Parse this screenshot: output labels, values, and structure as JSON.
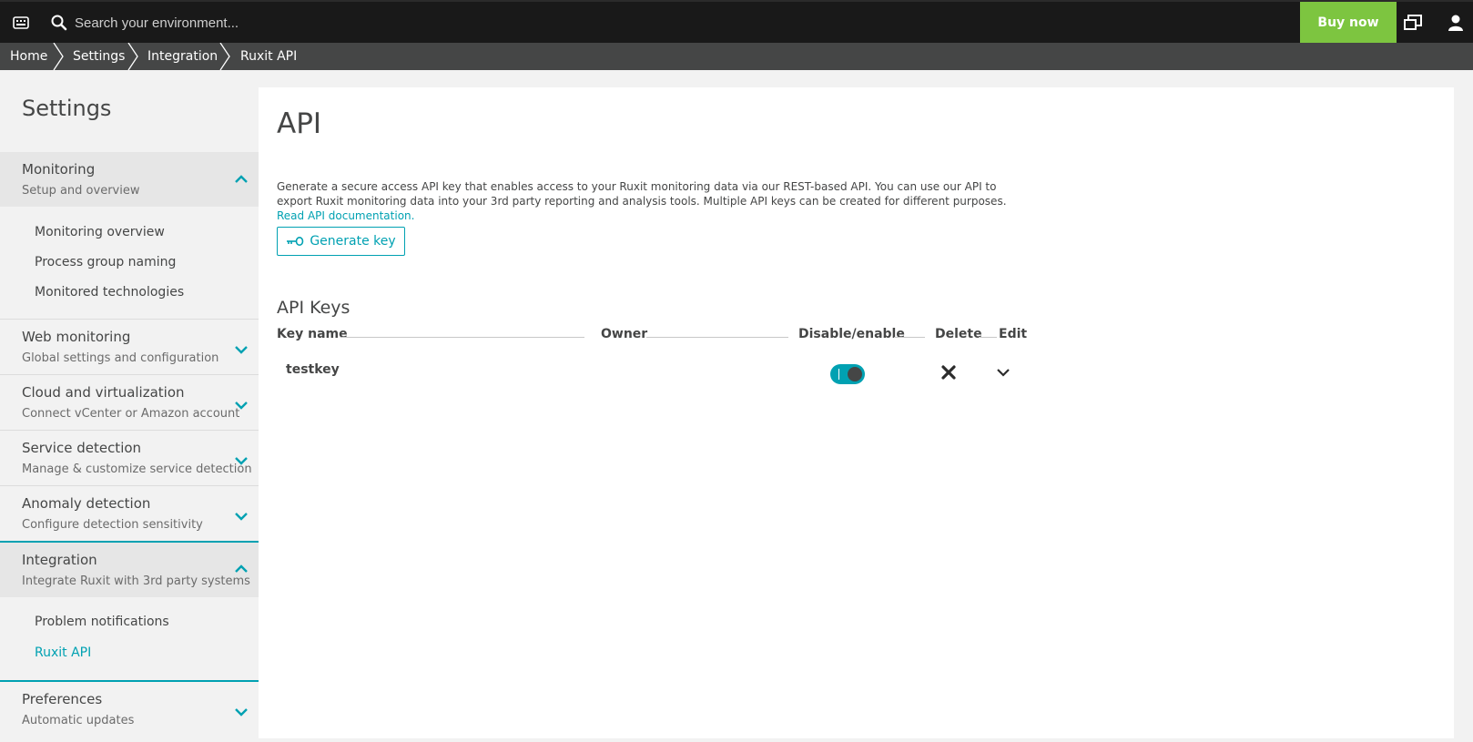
{
  "topbar": {
    "search_placeholder": "Search your environment...",
    "buy_label": "Buy now"
  },
  "breadcrumb": [
    "Home",
    "Settings",
    "Integration",
    "Ruxit API"
  ],
  "sidebar": {
    "title": "Settings",
    "sections": [
      {
        "title": "Monitoring",
        "subtitle": "Setup and overview",
        "expanded": true,
        "items": [
          "Monitoring overview",
          "Process group naming",
          "Monitored technologies"
        ]
      },
      {
        "title": "Web monitoring",
        "subtitle": "Global settings and configuration",
        "expanded": false
      },
      {
        "title": "Cloud and virtualization",
        "subtitle": "Connect vCenter or Amazon account",
        "expanded": false
      },
      {
        "title": "Service detection",
        "subtitle": "Manage & customize service detection",
        "expanded": false
      },
      {
        "title": "Anomaly detection",
        "subtitle": "Configure detection sensitivity",
        "expanded": false
      },
      {
        "title": "Integration",
        "subtitle": "Integrate Ruxit with 3rd party systems",
        "expanded": true,
        "items": [
          "Problem notifications",
          "Ruxit API"
        ],
        "current_item": "Ruxit API"
      },
      {
        "title": "Preferences",
        "subtitle": "Automatic updates",
        "expanded": false
      }
    ]
  },
  "main": {
    "title": "API",
    "description": "Generate a secure access API key that enables access to your Ruxit monitoring data via our REST-based API. You can use our API to export Ruxit monitoring data into your 3rd party reporting and analysis tools. Multiple API keys can be created for different purposes.",
    "doc_link": "Read API documentation.",
    "generate_label": "Generate key",
    "keys_title": "API Keys",
    "columns": [
      "Key name",
      "Owner",
      "Disable/enable",
      "Delete",
      "Edit"
    ],
    "rows": [
      {
        "name": "testkey",
        "owner": "",
        "enabled": true
      }
    ]
  },
  "colors": {
    "accent": "#00a1b2",
    "buy": "#7dc540",
    "topbar": "#191919",
    "breadcrumb": "#454646"
  }
}
